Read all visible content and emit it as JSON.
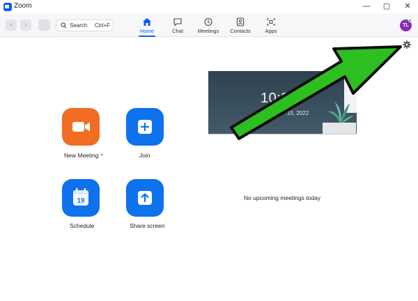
{
  "window": {
    "title": "Zoom",
    "controls": {
      "minimize": "—",
      "maximize": "▢",
      "close": "✕"
    }
  },
  "toolbar": {
    "back_icon": "chevron-left-icon",
    "forward_icon": "chevron-right-icon",
    "search": {
      "label": "Search",
      "shortcut": "Ctrl+F"
    },
    "tabs": [
      {
        "label": "Home",
        "icon": "home-icon",
        "active": true
      },
      {
        "label": "Chat",
        "icon": "chat-bubble-icon",
        "active": false
      },
      {
        "label": "Meetings",
        "icon": "clock-icon",
        "active": false
      },
      {
        "label": "Contacts",
        "icon": "contacts-icon",
        "active": false
      },
      {
        "label": "Apps",
        "icon": "apps-icon",
        "active": false
      }
    ],
    "avatar_initials": "TL"
  },
  "actions": {
    "new_meeting": "New Meeting",
    "join": "Join",
    "schedule": "Schedule",
    "schedule_day": "19",
    "share_screen": "Share screen"
  },
  "calendar_card": {
    "time": "10:2",
    "date": "15, 2022"
  },
  "meetings": {
    "empty_text": "No upcoming meetings today"
  },
  "colors": {
    "accent": "#0b5cff",
    "tile_blue": "#0e72ed",
    "tile_orange": "#f26d21",
    "annotation_arrow": "#2dbf1f"
  }
}
